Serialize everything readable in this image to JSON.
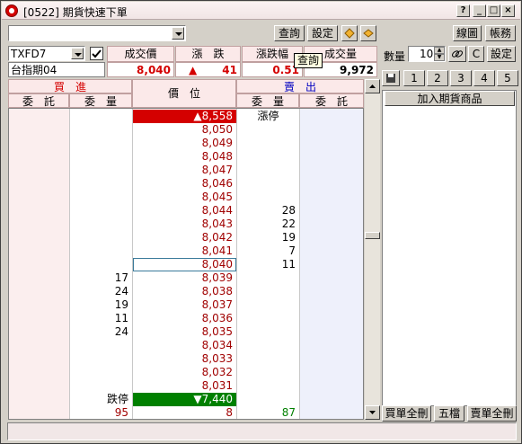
{
  "window": {
    "title": "[0522] 期貨快速下單",
    "help_label": "?",
    "min_label": "_",
    "max_label": "□",
    "close_label": "×"
  },
  "toolbar": {
    "query_label": "查詢",
    "settings_label": "設定",
    "chart_label": "線圖",
    "account_label": "帳務",
    "tooltip": "查詢"
  },
  "quote": {
    "symbol": "TXFD7",
    "name": "台指期04",
    "headers": [
      "成交價",
      "漲　跌",
      "漲跌幅",
      "成交量"
    ],
    "last_price": "8,040",
    "change": "41",
    "change_pct": "0.51",
    "volume": "9,972"
  },
  "orderbook": {
    "buy_title": "買　進",
    "sell_title": "賣　出",
    "price_title": "價　位",
    "sub_headers": [
      "委　託",
      "委　量",
      "委　量",
      "委　託"
    ],
    "limit_up_label": "漲停",
    "limit_down_label": "跌停",
    "limit_up_price": "▲8,558",
    "limit_down_price": "▼7,440",
    "rows": [
      {
        "bid": "",
        "price": "8,050",
        "ask": ""
      },
      {
        "bid": "",
        "price": "8,049",
        "ask": ""
      },
      {
        "bid": "",
        "price": "8,048",
        "ask": ""
      },
      {
        "bid": "",
        "price": "8,047",
        "ask": ""
      },
      {
        "bid": "",
        "price": "8,046",
        "ask": ""
      },
      {
        "bid": "",
        "price": "8,045",
        "ask": ""
      },
      {
        "bid": "",
        "price": "8,044",
        "ask": "28"
      },
      {
        "bid": "",
        "price": "8,043",
        "ask": "22"
      },
      {
        "bid": "",
        "price": "8,042",
        "ask": "19"
      },
      {
        "bid": "",
        "price": "8,041",
        "ask": "7"
      },
      {
        "bid": "",
        "price": "8,040",
        "ask": "11"
      },
      {
        "bid": "17",
        "price": "8,039",
        "ask": ""
      },
      {
        "bid": "24",
        "price": "8,038",
        "ask": ""
      },
      {
        "bid": "19",
        "price": "8,037",
        "ask": ""
      },
      {
        "bid": "11",
        "price": "8,036",
        "ask": ""
      },
      {
        "bid": "24",
        "price": "8,035",
        "ask": ""
      },
      {
        "bid": "",
        "price": "8,034",
        "ask": ""
      },
      {
        "bid": "",
        "price": "8,033",
        "ask": ""
      },
      {
        "bid": "",
        "price": "8,032",
        "ask": ""
      },
      {
        "bid": "",
        "price": "8,031",
        "ask": ""
      }
    ],
    "total_bid": "95",
    "total_price": "8",
    "total_ask": "87"
  },
  "right_panel": {
    "qty_label": "數量",
    "qty_value": "10",
    "c_label": "C",
    "settings_label": "設定",
    "quick_qty": [
      "1",
      "2",
      "3",
      "4",
      "5"
    ],
    "add_button": "加入期貨商品",
    "buy_clear": "買單全刪",
    "five_levels": "五檔",
    "sell_clear": "賣單全刪"
  },
  "colors": {
    "up": "#d40000",
    "down": "#008000",
    "price_text": "#a00000",
    "ask_text": "#000080"
  }
}
